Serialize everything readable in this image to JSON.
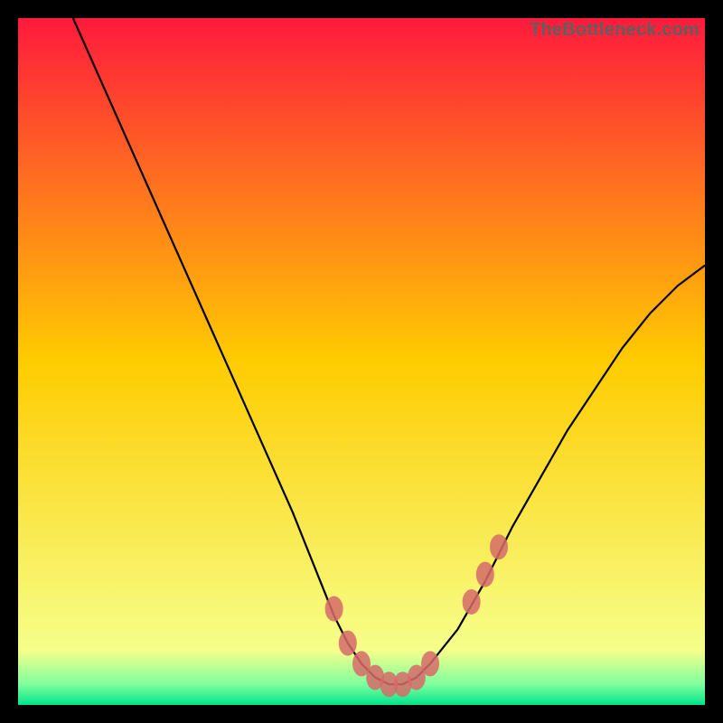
{
  "watermark": "TheBottleneck.com",
  "chart_data": {
    "type": "line",
    "title": "",
    "xlabel": "",
    "ylabel": "",
    "xlim": [
      0,
      100
    ],
    "ylim": [
      0,
      100
    ],
    "series": [
      {
        "name": "bottleneck-curve",
        "x": [
          8,
          12,
          16,
          20,
          24,
          28,
          32,
          36,
          40,
          44,
          46,
          48,
          50,
          52,
          54,
          56,
          58,
          60,
          64,
          68,
          72,
          76,
          80,
          84,
          88,
          92,
          96,
          100
        ],
        "y": [
          100,
          91,
          82,
          73,
          64,
          55,
          46,
          37,
          28,
          18,
          13,
          9,
          6,
          4,
          3,
          3,
          4,
          6,
          11,
          18,
          26,
          33,
          40,
          46,
          52,
          57,
          61,
          64
        ]
      }
    ],
    "markers": {
      "name": "highlight-dots",
      "x": [
        46,
        48,
        50,
        52,
        54,
        56,
        58,
        60,
        66,
        68,
        70
      ],
      "y": [
        14,
        9,
        6,
        4,
        3,
        3,
        4,
        6,
        15,
        19,
        23
      ]
    },
    "gradient_bands": [
      {
        "y": 100,
        "color": "#ff1a3c"
      },
      {
        "y": 50,
        "color": "#ffcc00"
      },
      {
        "y": 8,
        "color": "#f6ff8a"
      },
      {
        "y": 3,
        "color": "#7fff9e"
      },
      {
        "y": 0,
        "color": "#00e58a"
      }
    ]
  }
}
